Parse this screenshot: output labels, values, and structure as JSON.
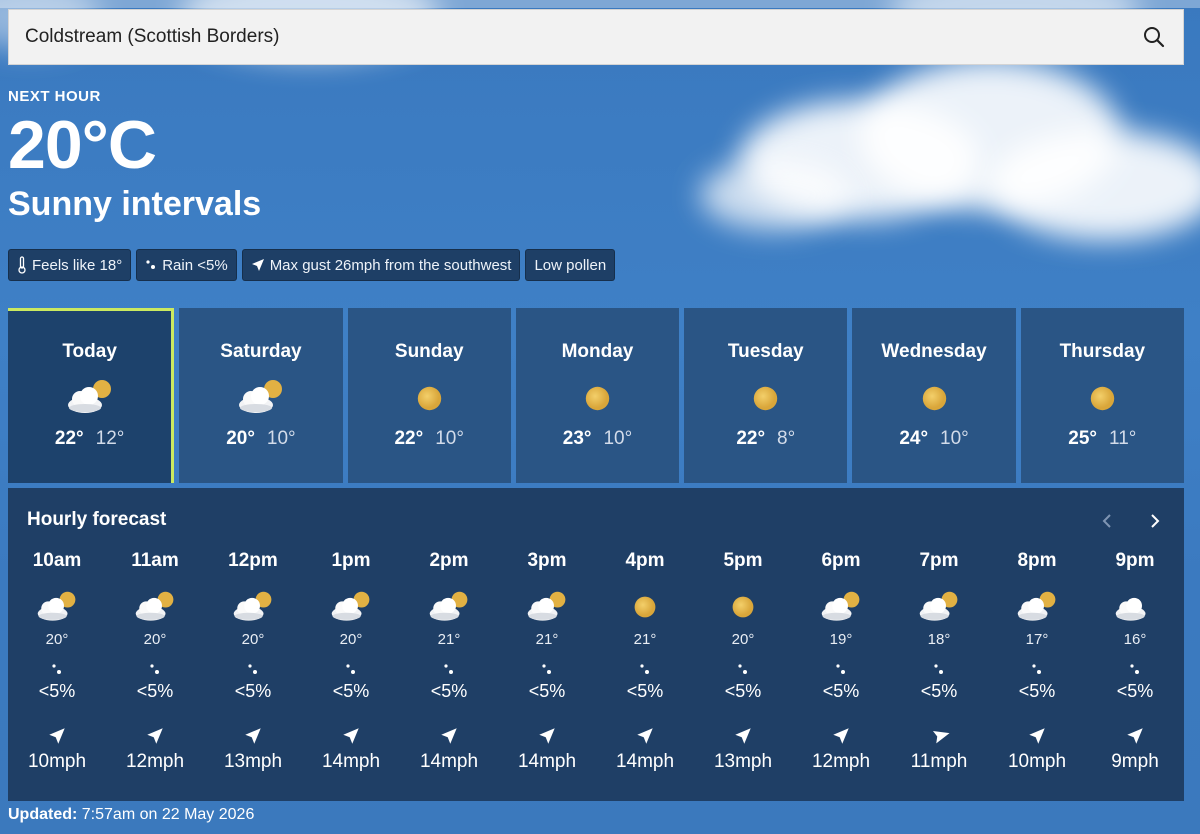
{
  "search": {
    "value": "Coldstream (Scottish Borders)",
    "icon": "search-icon"
  },
  "current": {
    "label": "NEXT HOUR",
    "temperature": "20°C",
    "condition": "Sunny intervals"
  },
  "chips": [
    {
      "icon": "thermometer-icon",
      "text": "Feels like 18°"
    },
    {
      "icon": "raindrops-icon",
      "text": "Rain <5%"
    },
    {
      "icon": "wind-arrow-icon",
      "text": "Max gust 26mph from the southwest"
    },
    {
      "icon": "",
      "text": "Low pollen"
    }
  ],
  "days": [
    {
      "name": "Today",
      "icon": "sun-cloud",
      "high": "22°",
      "low": "12°",
      "selected": true
    },
    {
      "name": "Saturday",
      "icon": "sun-cloud",
      "high": "20°",
      "low": "10°"
    },
    {
      "name": "Sunday",
      "icon": "sun",
      "high": "22°",
      "low": "10°"
    },
    {
      "name": "Monday",
      "icon": "sun",
      "high": "23°",
      "low": "10°"
    },
    {
      "name": "Tuesday",
      "icon": "sun",
      "high": "22°",
      "low": "8°"
    },
    {
      "name": "Wednesday",
      "icon": "sun",
      "high": "24°",
      "low": "10°"
    },
    {
      "name": "Thursday",
      "icon": "sun",
      "high": "25°",
      "low": "11°"
    }
  ],
  "hourly": {
    "title": "Hourly forecast",
    "hours": [
      {
        "time": "10am",
        "icon": "sun-cloud",
        "temp": "20°",
        "rain": "<5%",
        "wind": "10mph"
      },
      {
        "time": "11am",
        "icon": "sun-cloud",
        "temp": "20°",
        "rain": "<5%",
        "wind": "12mph"
      },
      {
        "time": "12pm",
        "icon": "sun-cloud",
        "temp": "20°",
        "rain": "<5%",
        "wind": "13mph"
      },
      {
        "time": "1pm",
        "icon": "sun-cloud",
        "temp": "20°",
        "rain": "<5%",
        "wind": "14mph"
      },
      {
        "time": "2pm",
        "icon": "sun-cloud",
        "temp": "21°",
        "rain": "<5%",
        "wind": "14mph"
      },
      {
        "time": "3pm",
        "icon": "sun-cloud",
        "temp": "21°",
        "rain": "<5%",
        "wind": "14mph"
      },
      {
        "time": "4pm",
        "icon": "sun",
        "temp": "21°",
        "rain": "<5%",
        "wind": "14mph"
      },
      {
        "time": "5pm",
        "icon": "sun",
        "temp": "20°",
        "rain": "<5%",
        "wind": "13mph"
      },
      {
        "time": "6pm",
        "icon": "sun-cloud",
        "temp": "19°",
        "rain": "<5%",
        "wind": "12mph"
      },
      {
        "time": "7pm",
        "icon": "sun-cloud",
        "temp": "18°",
        "rain": "<5%",
        "wind": "11mph"
      },
      {
        "time": "8pm",
        "icon": "sun-cloud",
        "temp": "17°",
        "rain": "<5%",
        "wind": "10mph"
      },
      {
        "time": "9pm",
        "icon": "cloud",
        "temp": "16°",
        "rain": "<5%",
        "wind": "9mph"
      }
    ]
  },
  "updated": {
    "label": "Updated:",
    "text": "7:57am on 22 May 2026"
  },
  "colors": {
    "sky": "#3f80c6",
    "panel": "#2a5585",
    "panel_dark": "#1f3f66",
    "selected_accent": "#cbe960",
    "sun": "#e6b84a"
  }
}
